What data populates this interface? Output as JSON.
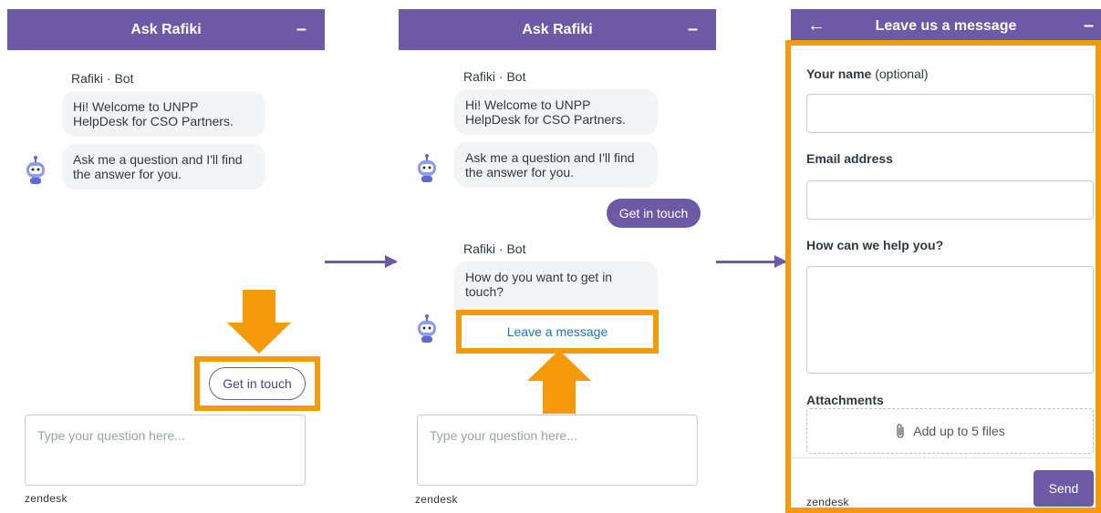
{
  "panel1": {
    "title": "Ask Rafiki",
    "minimize": "–",
    "sender": "Rafiki · Bot",
    "messages": [
      "Hi! Welcome to UNPP HelpDesk for CSO Partners.",
      "Ask me a question and I'll find the answer for you."
    ],
    "action_button": "Get in touch",
    "input_placeholder": "Type your question here...",
    "brand": "zendesk"
  },
  "panel2": {
    "title": "Ask Rafiki",
    "minimize": "–",
    "sender": "Rafiki · Bot",
    "messages": [
      "Hi! Welcome to UNPP HelpDesk for CSO Partners.",
      "Ask me a question and I'll find the answer for you."
    ],
    "user_message": "Get in touch",
    "sender2": "Rafiki · Bot",
    "question": "How do you want to get in touch?",
    "option": "Leave a message",
    "input_placeholder": "Type your question here...",
    "brand": "zendesk"
  },
  "panel3": {
    "back": "←",
    "title": "Leave us a message",
    "minimize": "–",
    "name_label": "Your name",
    "name_optional": "(optional)",
    "email_label": "Email address",
    "help_label": "How can we help you?",
    "attachments_label": "Attachments",
    "attachments_hint": "Add up to 5 files",
    "send": "Send",
    "brand": "zendesk"
  },
  "colors": {
    "brand_purple": "#6d5aa6",
    "highlight_orange": "#f59a0a",
    "bubble_bg": "#f3f4f6"
  }
}
